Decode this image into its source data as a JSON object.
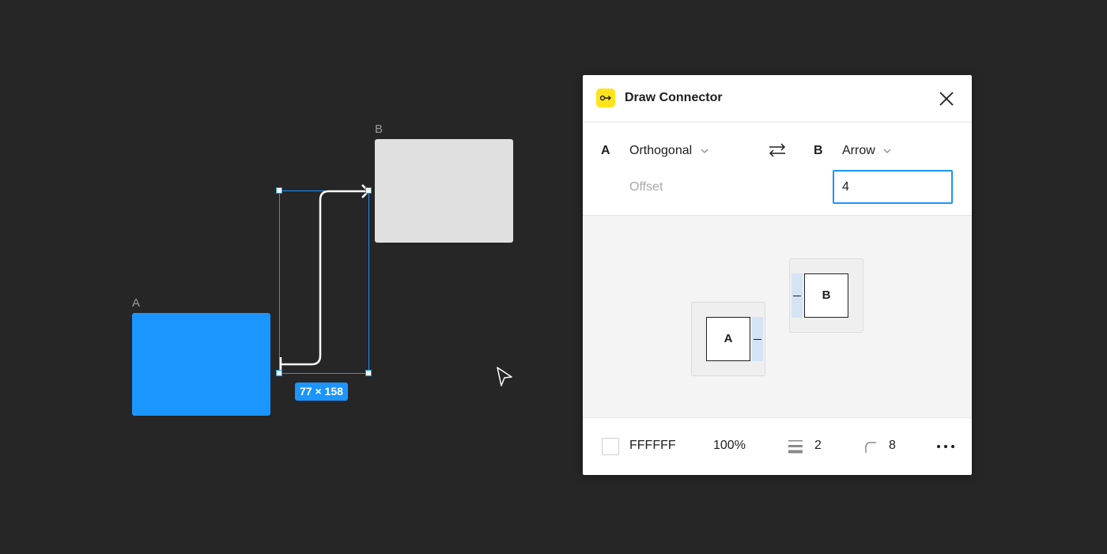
{
  "canvas": {
    "frame_a_label": "A",
    "frame_b_label": "B",
    "selection_size": "77 × 158",
    "colors": {
      "background": "#262626",
      "frame_a": "#1b95ff",
      "frame_b": "#e0e0e0",
      "selection": "#1b95ff"
    }
  },
  "panel": {
    "title": "Draw Connector",
    "plugin_icon": "connector-icon",
    "close_icon": "close-icon",
    "side_a": {
      "letter": "A",
      "style": "Orthogonal"
    },
    "swap_icon": "swap-arrows-icon",
    "side_b": {
      "letter": "B",
      "style": "Arrow"
    },
    "offset": {
      "label": "Offset",
      "value": "4"
    },
    "preview": {
      "box_a": "A",
      "box_b": "B"
    },
    "footer": {
      "color_hex": "FFFFFF",
      "opacity": "100%",
      "stroke_weight": "2",
      "corner_radius": "8",
      "stroke_icon": "stroke-weight-icon",
      "radius_icon": "corner-radius-icon",
      "more_icon": "more-dots-icon"
    },
    "colors": {
      "accent": "#1b95ff",
      "plugin_yellow": "#ffe41c",
      "preview_bg": "#f4f4f4",
      "side_highlight": "#d4e4f5"
    }
  }
}
